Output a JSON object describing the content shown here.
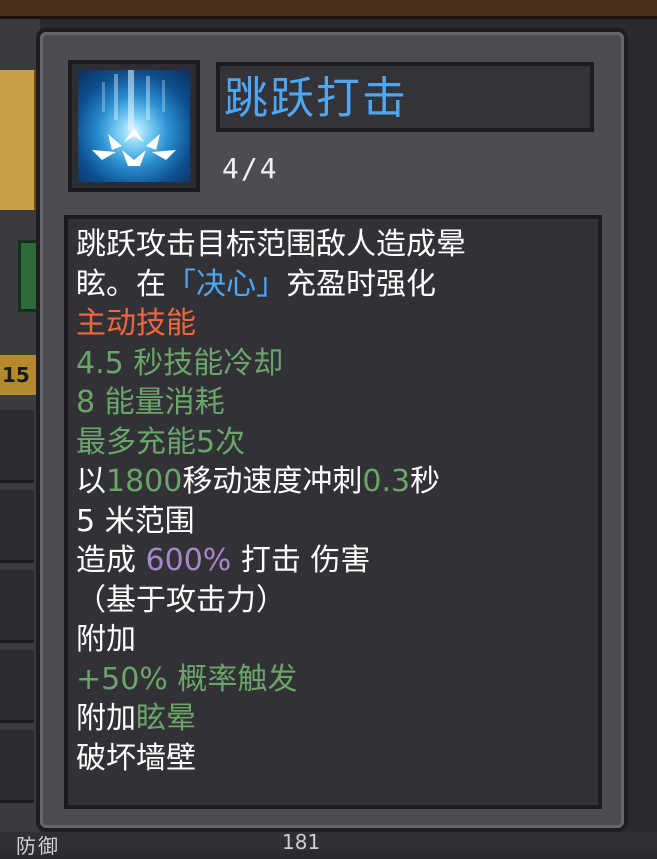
{
  "skill": {
    "name": "跳跃打击",
    "level": "4/4",
    "icon": "ice-shockwave-icon"
  },
  "description": {
    "line1": "跳跃攻击目标范围敌人造成晕",
    "line2_prefix": "眩。在",
    "line2_keyword": "「决心」",
    "line2_suffix": "充盈时强化",
    "type": "主动技能",
    "cooldown": "4.5 秒技能冷却",
    "energy_cost": "8 能量消耗",
    "charges": "最多充能5次",
    "dash_prefix": "以",
    "dash_speed": "1800",
    "dash_mid": "移动速度冲刺",
    "dash_time": "0.3",
    "dash_suffix": "秒",
    "range": "5 米范围",
    "damage_prefix": "造成 ",
    "damage_percent": "600%",
    "damage_suffix": " 打击 伤害",
    "damage_basis": "（基于攻击力）",
    "attach_label": "附加",
    "proc_chance": "+50% 概率触发",
    "attach_stun_prefix": "附加",
    "attach_stun": "眩晕",
    "wall_break": "破坏墙壁"
  },
  "background": {
    "level_chip": "15",
    "bottom_label": "防御",
    "bottom_value": "181"
  },
  "colors": {
    "title": "#4fa6f2",
    "keyword": "#4fa6f2",
    "type": "#f2663c",
    "stat_green": "#6aa56a",
    "damage_purple": "#a985c9",
    "panel": "#4c4c52",
    "desc_bg": "#313136"
  }
}
